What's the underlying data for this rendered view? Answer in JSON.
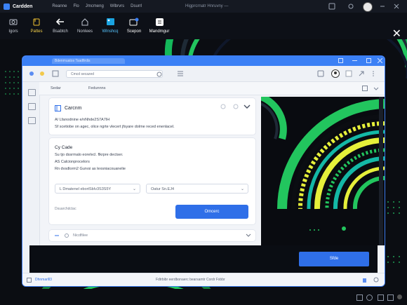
{
  "app": {
    "name": "Cardden",
    "menu": [
      "Reanne",
      "Flo",
      "Jmcmeng",
      "Wlbrvrs",
      "Dsurrl"
    ],
    "center_text": "Higprcrnatr  Hnruvny  —"
  },
  "toolbar": {
    "tools": [
      {
        "label": "Igors",
        "icon": "camera-icon"
      },
      {
        "label": "Pattes",
        "icon": "clipboard-icon"
      },
      {
        "label": "Bsabtch",
        "icon": "back-arrow-icon"
      },
      {
        "label": "Nonlees",
        "icon": "home-icon"
      },
      {
        "label": "Wlnshcq",
        "icon": "image-icon"
      },
      {
        "label": "Scepon",
        "icon": "screen-icon"
      },
      {
        "label": "Mandmgur",
        "icon": "document-icon"
      }
    ]
  },
  "window": {
    "tab_label": "Bdenmuatos Tsadfirdis",
    "address_placeholder": "Cmcd secazed",
    "subbar": {
      "item1": "Sedar",
      "item2": "Fedunnns"
    }
  },
  "card1": {
    "title": "Carcnm",
    "line1": "A/ Lfanodnine e/nNhde2S7A7IH",
    "line2": "Sf scetiobe on agec, olice ngrte vlecert jfsyare dolme reced enenlacel."
  },
  "card2": {
    "title": "Cy Cade",
    "lines": [
      "Su tjo dssrmalo eorelvcl. flkrpre dectser.",
      "AS  Calcionprocelors",
      "Rn dvsdlorm2 Gurvsi as lexsniacouanelie"
    ],
    "select1": "L  Dmatenel  ebortSbIv3S3S5Y",
    "select2": "Oatur Sn.EJ4",
    "hint": "Dsuarchdctac",
    "button": "Omcerc"
  },
  "footer_card": {
    "text": "Nicdfilee"
  },
  "dark_strip": {
    "button": "Sfde"
  },
  "statusbar": {
    "left": "Dhnmarlll3",
    "center": "Fdtrbibr eerdbonaerc bearsamtr Cordr Fxbbr"
  },
  "colors": {
    "accent": "#2f6fe8",
    "title_bar": "#3b80f5",
    "art_green": "#22c55e",
    "art_yellow": "#e6f03a",
    "art_teal": "#14b8a6"
  }
}
